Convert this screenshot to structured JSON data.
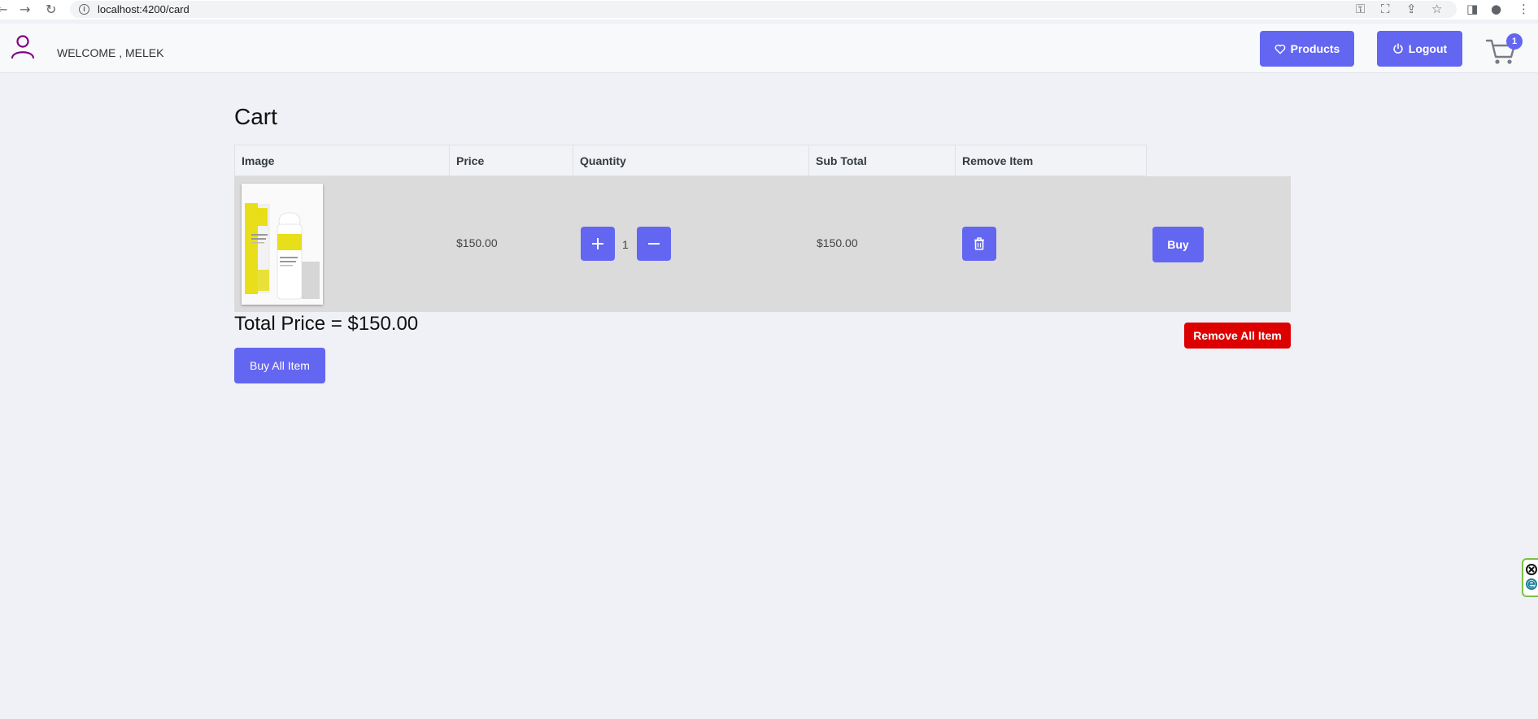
{
  "browser": {
    "url": "localhost:4200/card",
    "back_icon": "arrow-left-icon",
    "forward_icon": "arrow-right-icon",
    "reload_icon": "reload-icon"
  },
  "header": {
    "welcome_text": "WELCOME , MELEK",
    "products_label": "Products",
    "logout_label": "Logout",
    "cart_count": "1",
    "accent_color": "#6366f1"
  },
  "cart": {
    "title": "Cart",
    "columns": [
      "Image",
      "Price",
      "Quantity",
      "Sub Total",
      "Remove Item"
    ],
    "items": [
      {
        "price": "$150.00",
        "quantity": "1",
        "subtotal": "$150.00",
        "buy_label": "Buy"
      }
    ],
    "total_text": "Total Price = $150.00",
    "remove_all_label": "Remove All Item",
    "buy_all_label": "Buy All Item",
    "danger_color": "#dd0000"
  }
}
